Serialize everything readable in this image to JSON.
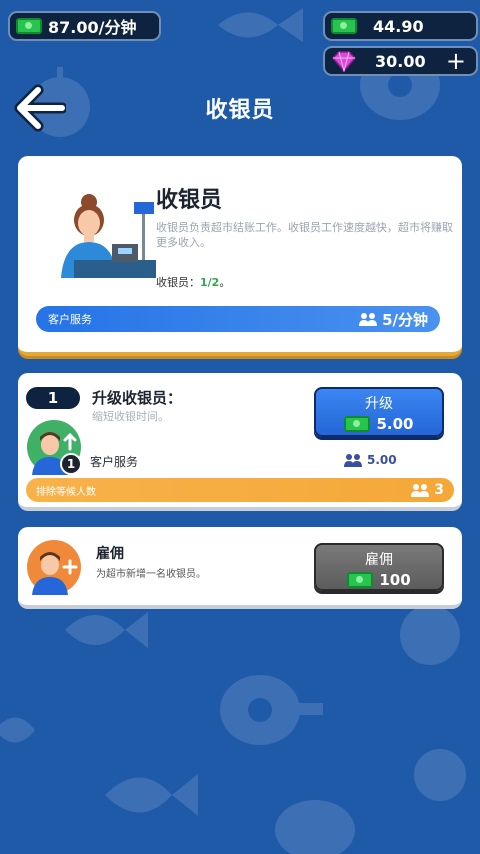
{
  "header": {
    "income_rate": "87.00/分钟",
    "cash_balance": "44.90",
    "gem_balance": "30.00",
    "add_gems_label": "+",
    "title": "收银员"
  },
  "role_card": {
    "title": "收银员",
    "description": "收银员负责超市结账工作。收银员工作速度越快，超市将赚取更多收入。",
    "count_label": "收银员：",
    "count_value": "1/2",
    "count_suffix": "。",
    "stat_label": "客户服务",
    "stat_value": "5/分钟"
  },
  "upgrade_card": {
    "level": "1",
    "title": "升级收银员：",
    "subtitle": "缩短收银时间。",
    "avatar_badge": "1",
    "service_label": "客户服务",
    "service_value": "5.00",
    "button_label": "升级",
    "button_price": "5.00",
    "queue_label": "排除等候人数",
    "queue_value": "3"
  },
  "hire_card": {
    "title": "雇佣",
    "subtitle": "为超市新增一名收银员。",
    "button_label": "雇佣",
    "button_price": "100"
  },
  "colors": {
    "background": "#1f5aa8",
    "cash_green": "#27c44f",
    "gem_pink": "#d94ad8",
    "upgrade_blue": "#2f74e6",
    "hire_gray": "#6b6b6b",
    "queue_orange": "#f5a838"
  }
}
